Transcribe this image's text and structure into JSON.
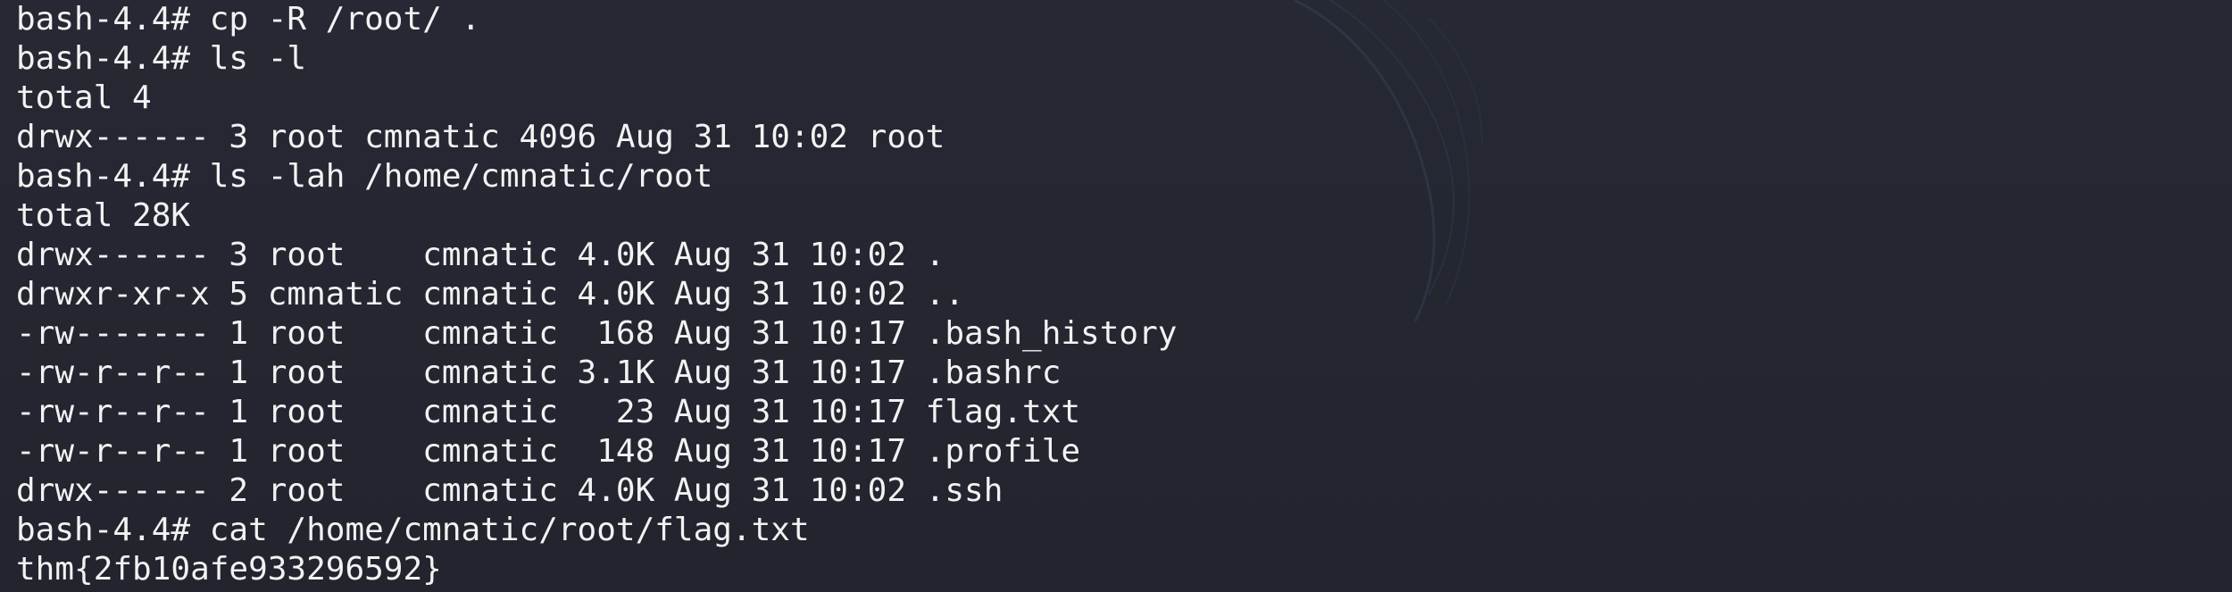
{
  "terminal": {
    "lines": [
      "bash-4.4# cp -R /root/ .",
      "bash-4.4# ls -l",
      "total 4",
      "drwx------ 3 root cmnatic 4096 Aug 31 10:02 root",
      "bash-4.4# ls -lah /home/cmnatic/root",
      "total 28K",
      "drwx------ 3 root    cmnatic 4.0K Aug 31 10:02 .",
      "drwxr-xr-x 5 cmnatic cmnatic 4.0K Aug 31 10:02 ..",
      "-rw------- 1 root    cmnatic  168 Aug 31 10:17 .bash_history",
      "-rw-r--r-- 1 root    cmnatic 3.1K Aug 31 10:17 .bashrc",
      "-rw-r--r-- 1 root    cmnatic   23 Aug 31 10:17 flag.txt",
      "-rw-r--r-- 1 root    cmnatic  148 Aug 31 10:17 .profile",
      "drwx------ 2 root    cmnatic 4.0K Aug 31 10:02 .ssh",
      "bash-4.4# cat /home/cmnatic/root/flag.txt",
      "thm{2fb10afe933296592}"
    ]
  },
  "colors": {
    "background": "#232530",
    "text": "#f2f2f2",
    "wallpaper_accent": "#3a4458"
  },
  "icons": {
    "wallpaper": "kali-dragon-outline"
  }
}
